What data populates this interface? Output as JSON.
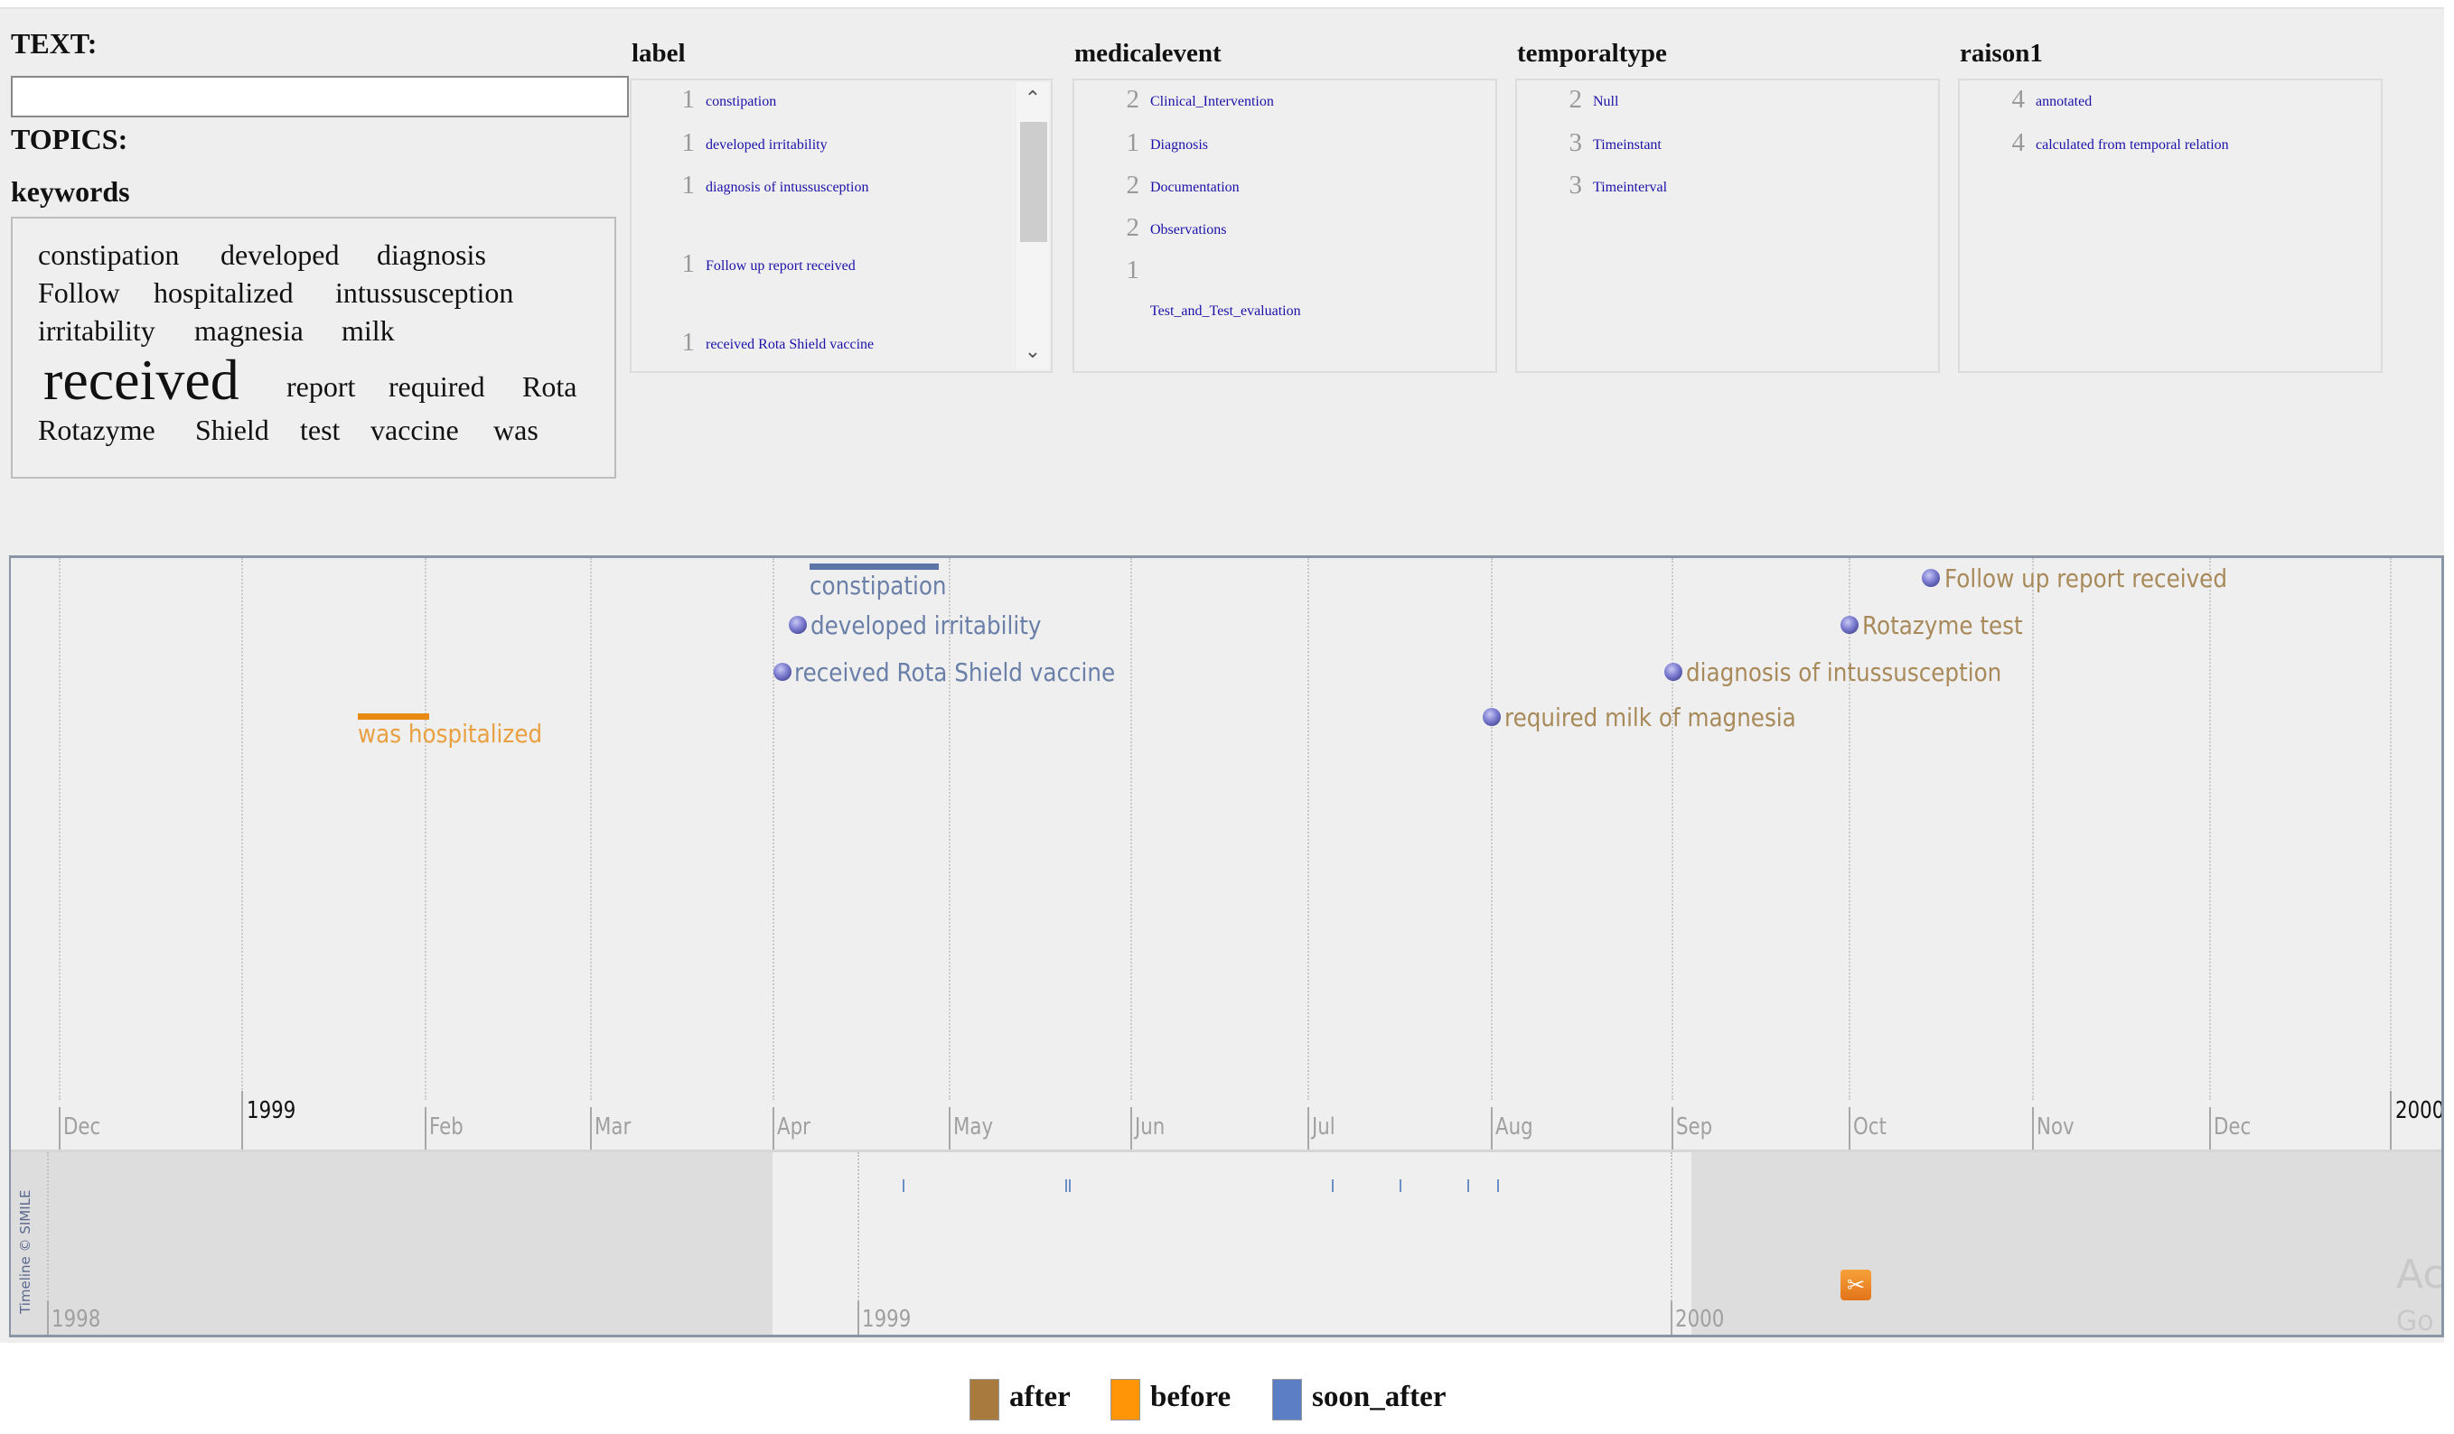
{
  "search": {
    "text_label": "TEXT:",
    "text_value": "",
    "topics_label": "TOPICS:",
    "keywords_label": "keywords"
  },
  "keywords": [
    {
      "word": "constipation",
      "size": "normal"
    },
    {
      "word": "developed",
      "size": "normal"
    },
    {
      "word": "diagnosis",
      "size": "normal"
    },
    {
      "word": "Follow",
      "size": "normal"
    },
    {
      "word": "hospitalized",
      "size": "normal"
    },
    {
      "word": "intussusception",
      "size": "normal"
    },
    {
      "word": "irritability",
      "size": "normal"
    },
    {
      "word": "magnesia",
      "size": "normal"
    },
    {
      "word": "milk",
      "size": "normal"
    },
    {
      "word": "received",
      "size": "large"
    },
    {
      "word": "report",
      "size": "normal"
    },
    {
      "word": "required",
      "size": "normal"
    },
    {
      "word": "Rota",
      "size": "normal"
    },
    {
      "word": "Rotazyme",
      "size": "normal"
    },
    {
      "word": "Shield",
      "size": "normal"
    },
    {
      "word": "test",
      "size": "normal"
    },
    {
      "word": "vaccine",
      "size": "normal"
    },
    {
      "word": "was",
      "size": "normal"
    }
  ],
  "facets": [
    {
      "title": "label",
      "items": [
        {
          "count": "1",
          "value": "constipation"
        },
        {
          "count": "1",
          "value": "developed irritability"
        },
        {
          "count": "1",
          "value": "diagnosis of intussusception"
        },
        {
          "count": "1",
          "value": "Follow up report received"
        },
        {
          "count": "1",
          "value": "received Rota Shield vaccine"
        }
      ],
      "scrollable": true
    },
    {
      "title": "medicalevent",
      "items": [
        {
          "count": "2",
          "value": "Clinical_Intervention"
        },
        {
          "count": "1",
          "value": "Diagnosis"
        },
        {
          "count": "2",
          "value": "Documentation"
        },
        {
          "count": "2",
          "value": "Observations"
        },
        {
          "count": "1",
          "value": "Test_and_Test_evaluation"
        }
      ]
    },
    {
      "title": "temporaltype",
      "items": [
        {
          "count": "2",
          "value": "Null"
        },
        {
          "count": "3",
          "value": "Timeinstant"
        },
        {
          "count": "3",
          "value": "Timeinterval"
        }
      ]
    },
    {
      "title": "raison1",
      "items": [
        {
          "count": "4",
          "value": "annotated"
        },
        {
          "count": "4",
          "value": "calculated from temporal relation"
        }
      ]
    }
  ],
  "timeline": {
    "axis_labels": [
      "Dec",
      "1999",
      "Feb",
      "Mar",
      "Apr",
      "May",
      "Jun",
      "Jul",
      "Aug",
      "Sep",
      "Oct",
      "Nov",
      "Dec",
      "2000"
    ],
    "overview_labels": [
      "1998",
      "1999",
      "2000"
    ],
    "copyright": "Timeline © SIMILE",
    "events": [
      {
        "label": "constipation",
        "type": "interval",
        "relation": "soon_after"
      },
      {
        "label": "developed irritability",
        "type": "instant",
        "relation": "soon_after"
      },
      {
        "label": "received Rota Shield vaccine",
        "type": "instant",
        "relation": "soon_after"
      },
      {
        "label": "was hospitalized",
        "type": "interval",
        "relation": "before"
      },
      {
        "label": "required milk of magnesia",
        "type": "instant",
        "relation": "after"
      },
      {
        "label": "diagnosis of intussusception",
        "type": "instant",
        "relation": "after"
      },
      {
        "label": "Rotazyme test",
        "type": "instant",
        "relation": "after"
      },
      {
        "label": "Follow up report received",
        "type": "instant",
        "relation": "after"
      }
    ],
    "watermark": [
      "Ac",
      "Go"
    ]
  },
  "legend": [
    {
      "label": "after",
      "color": "#a87a3e"
    },
    {
      "label": "before",
      "color": "#ff9507"
    },
    {
      "label": "soon_after",
      "color": "#5b7ec4"
    }
  ],
  "colors": {
    "after_text": "#a88a5a",
    "before_text": "#e8a040",
    "before_bar": "#e98a12",
    "soon_after_text": "#6a7fa8",
    "soon_after_bar": "#5d75a6",
    "link": "#1c12a8"
  }
}
